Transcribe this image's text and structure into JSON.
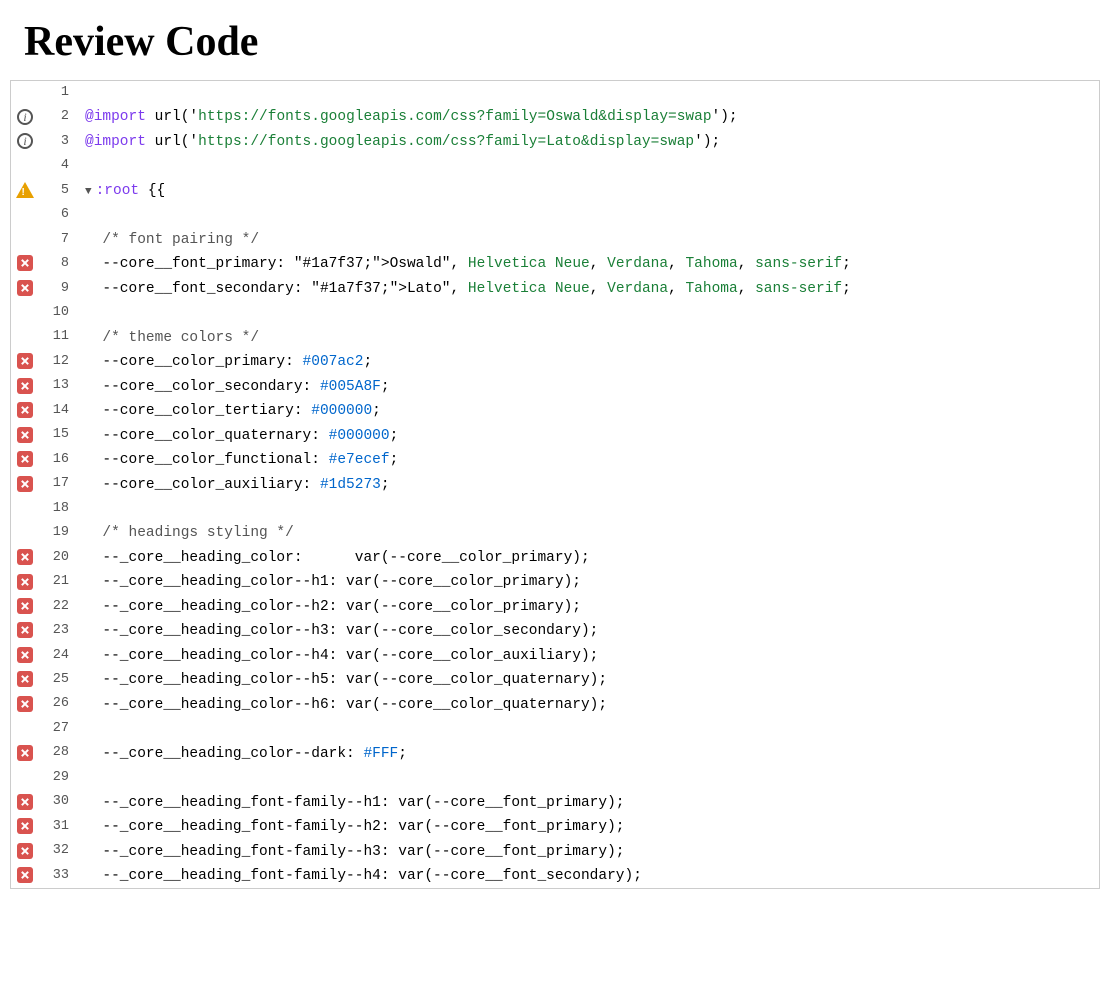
{
  "page": {
    "title": "Review Code"
  },
  "code": {
    "lines": [
      {
        "num": 1,
        "icon": null,
        "content": "",
        "fold": false
      },
      {
        "num": 2,
        "icon": "info",
        "content": "@import url('https://fonts.googleapis.com/css?family=Oswald&display=swap');",
        "fold": false
      },
      {
        "num": 3,
        "icon": "info",
        "content": "@import url('https://fonts.googleapis.com/css?family=Lato&display=swap');",
        "fold": false
      },
      {
        "num": 4,
        "icon": null,
        "content": "",
        "fold": false
      },
      {
        "num": 5,
        "icon": "warning",
        "content": ":root {",
        "fold": true
      },
      {
        "num": 6,
        "icon": null,
        "content": "",
        "fold": false
      },
      {
        "num": 7,
        "icon": null,
        "content": "  /* font pairing */",
        "fold": false
      },
      {
        "num": 8,
        "icon": "error",
        "content": "  --core__font_primary: \"Oswald\", Helvetica Neue, Verdana, Tahoma, sans-serif;",
        "fold": false
      },
      {
        "num": 9,
        "icon": "error",
        "content": "  --core__font_secondary: \"Lato\", Helvetica Neue, Verdana, Tahoma, sans-serif;",
        "fold": false
      },
      {
        "num": 10,
        "icon": null,
        "content": "",
        "fold": false
      },
      {
        "num": 11,
        "icon": null,
        "content": "  /* theme colors */",
        "fold": false
      },
      {
        "num": 12,
        "icon": "error",
        "content": "  --core__color_primary: #007ac2;",
        "fold": false
      },
      {
        "num": 13,
        "icon": "error",
        "content": "  --core__color_secondary: #005A8F;",
        "fold": false
      },
      {
        "num": 14,
        "icon": "error",
        "content": "  --core__color_tertiary: #000000;",
        "fold": false
      },
      {
        "num": 15,
        "icon": "error",
        "content": "  --core__color_quaternary: #000000;",
        "fold": false
      },
      {
        "num": 16,
        "icon": "error",
        "content": "  --core__color_functional: #e7ecef;",
        "fold": false
      },
      {
        "num": 17,
        "icon": "error",
        "content": "  --core__color_auxiliary: #1d5273;",
        "fold": false
      },
      {
        "num": 18,
        "icon": null,
        "content": "",
        "fold": false
      },
      {
        "num": 19,
        "icon": null,
        "content": "  /* headings styling */",
        "fold": false
      },
      {
        "num": 20,
        "icon": "error",
        "content": "  --_core__heading_color:      var(--core__color_primary);",
        "fold": false
      },
      {
        "num": 21,
        "icon": "error",
        "content": "  --_core__heading_color--h1: var(--core__color_primary);",
        "fold": false
      },
      {
        "num": 22,
        "icon": "error",
        "content": "  --_core__heading_color--h2: var(--core__color_primary);",
        "fold": false
      },
      {
        "num": 23,
        "icon": "error",
        "content": "  --_core__heading_color--h3: var(--core__color_secondary);",
        "fold": false
      },
      {
        "num": 24,
        "icon": "error",
        "content": "  --_core__heading_color--h4: var(--core__color_auxiliary);",
        "fold": false
      },
      {
        "num": 25,
        "icon": "error",
        "content": "  --_core__heading_color--h5: var(--core__color_quaternary);",
        "fold": false
      },
      {
        "num": 26,
        "icon": "error",
        "content": "  --_core__heading_color--h6: var(--core__color_quaternary);",
        "fold": false
      },
      {
        "num": 27,
        "icon": null,
        "content": "",
        "fold": false
      },
      {
        "num": 28,
        "icon": "error",
        "content": "  --_core__heading_color--dark: #FFF;",
        "fold": false
      },
      {
        "num": 29,
        "icon": null,
        "content": "",
        "fold": false
      },
      {
        "num": 30,
        "icon": "error",
        "content": "  --_core__heading_font-family--h1: var(--core__font_primary);",
        "fold": false
      },
      {
        "num": 31,
        "icon": "error",
        "content": "  --_core__heading_font-family--h2: var(--core__font_primary);",
        "fold": false
      },
      {
        "num": 32,
        "icon": "error",
        "content": "  --_core__heading_font-family--h3: var(--core__font_primary);",
        "fold": false
      },
      {
        "num": 33,
        "icon": "error",
        "content": "  --_core__heading_font-family--h4: var(--core__font_secondary);",
        "fold": false
      }
    ]
  }
}
